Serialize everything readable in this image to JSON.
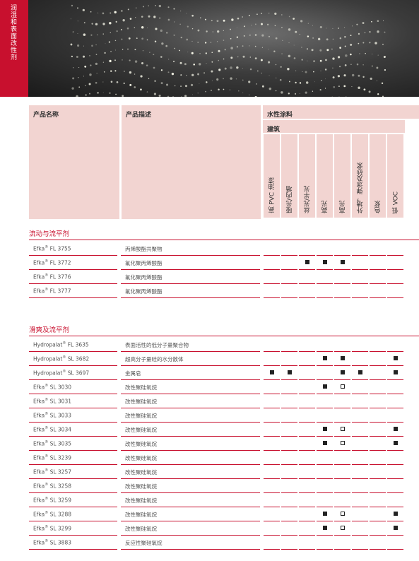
{
  "side_title": "润湿和表面改性剂",
  "header": {
    "product_name": "产品名称",
    "product_desc": "产品描述",
    "waterborne": "水性涂料",
    "architectural": "建筑",
    "columns": [
      "高 PVC 油漆",
      "哑光/内墙",
      "丝光/半光",
      "高光",
      "高光",
      "外墙，弹涂及砂浆",
      "色浆",
      "低 VOC"
    ]
  },
  "sections": [
    {
      "title": "流动与流平剂",
      "rows": [
        {
          "brand": "Efka",
          "code": "FL 3755",
          "desc": "丙烯酸酯共聚物",
          "marks": [
            "",
            "",
            "",
            "",
            "",
            "",
            "",
            ""
          ]
        },
        {
          "brand": "Efka",
          "code": "FL 3772",
          "desc": "氟化聚丙烯酸酯",
          "marks": [
            "",
            "",
            "filled",
            "filled",
            "filled",
            "",
            "",
            ""
          ]
        },
        {
          "brand": "Efka",
          "code": "FL 3776",
          "desc": "氟化聚丙烯酸酯",
          "marks": [
            "",
            "",
            "",
            "",
            "",
            "",
            "",
            ""
          ]
        },
        {
          "brand": "Efka",
          "code": "FL 3777",
          "desc": "氟化聚丙烯酸酯",
          "marks": [
            "",
            "",
            "",
            "",
            "",
            "",
            "",
            ""
          ]
        }
      ]
    },
    {
      "title": "滑爽及流平剂",
      "rows": [
        {
          "brand": "Hydropalat",
          "code": "FL 3635",
          "desc": "表面活性的低分子量聚合物",
          "marks": [
            "",
            "",
            "",
            "",
            "",
            "",
            "",
            ""
          ]
        },
        {
          "brand": "Hydropalat",
          "code": "SL 3682",
          "desc": "超高分子量硅的水分散体",
          "marks": [
            "",
            "",
            "",
            "filled",
            "filled",
            "",
            "",
            "filled"
          ]
        },
        {
          "brand": "Hydropalat",
          "code": "SL 3697",
          "desc": "金属皂",
          "marks": [
            "filled",
            "filled",
            "",
            "",
            "filled",
            "filled",
            "",
            "filled"
          ]
        },
        {
          "brand": "Efka",
          "code": "SL 3030",
          "desc": "改性聚硅氧烷",
          "marks": [
            "",
            "",
            "",
            "filled",
            "open",
            "",
            "",
            ""
          ]
        },
        {
          "brand": "Efka",
          "code": "SL 3031",
          "desc": "改性聚硅氧烷",
          "marks": [
            "",
            "",
            "",
            "",
            "",
            "",
            "",
            ""
          ]
        },
        {
          "brand": "Efka",
          "code": "SL 3033",
          "desc": "改性聚硅氧烷",
          "marks": [
            "",
            "",
            "",
            "",
            "",
            "",
            "",
            ""
          ]
        },
        {
          "brand": "Efka",
          "code": "SL 3034",
          "desc": "改性聚硅氧烷",
          "marks": [
            "",
            "",
            "",
            "filled",
            "open",
            "",
            "",
            "filled"
          ]
        },
        {
          "brand": "Efka",
          "code": "SL 3035",
          "desc": "改性聚硅氧烷",
          "marks": [
            "",
            "",
            "",
            "filled",
            "open",
            "",
            "",
            "filled"
          ]
        },
        {
          "brand": "Efka",
          "code": "SL 3239",
          "desc": "改性聚硅氧烷",
          "marks": [
            "",
            "",
            "",
            "",
            "",
            "",
            "",
            ""
          ]
        },
        {
          "brand": "Efka",
          "code": "SL 3257",
          "desc": "改性聚硅氧烷",
          "marks": [
            "",
            "",
            "",
            "",
            "",
            "",
            "",
            ""
          ]
        },
        {
          "brand": "Efka",
          "code": "SL 3258",
          "desc": "改性聚硅氧烷",
          "marks": [
            "",
            "",
            "",
            "",
            "",
            "",
            "",
            ""
          ]
        },
        {
          "brand": "Efka",
          "code": "SL 3259",
          "desc": "改性聚硅氧烷",
          "marks": [
            "",
            "",
            "",
            "",
            "",
            "",
            "",
            ""
          ]
        },
        {
          "brand": "Efka",
          "code": "SL 3288",
          "desc": "改性聚硅氧烷",
          "marks": [
            "",
            "",
            "",
            "filled",
            "open",
            "",
            "",
            "filled"
          ]
        },
        {
          "brand": "Efka",
          "code": "SL 3299",
          "desc": "改性聚硅氧烷",
          "marks": [
            "",
            "",
            "",
            "filled",
            "open",
            "",
            "",
            "filled"
          ]
        },
        {
          "brand": "Efka",
          "code": "SL 3883",
          "desc": "反应性聚硅氧烷",
          "marks": [
            "",
            "",
            "",
            "",
            "",
            "",
            "",
            ""
          ]
        }
      ]
    }
  ],
  "colors": {
    "accent": "#c8102e",
    "header_bg": "#f2d4d1"
  }
}
